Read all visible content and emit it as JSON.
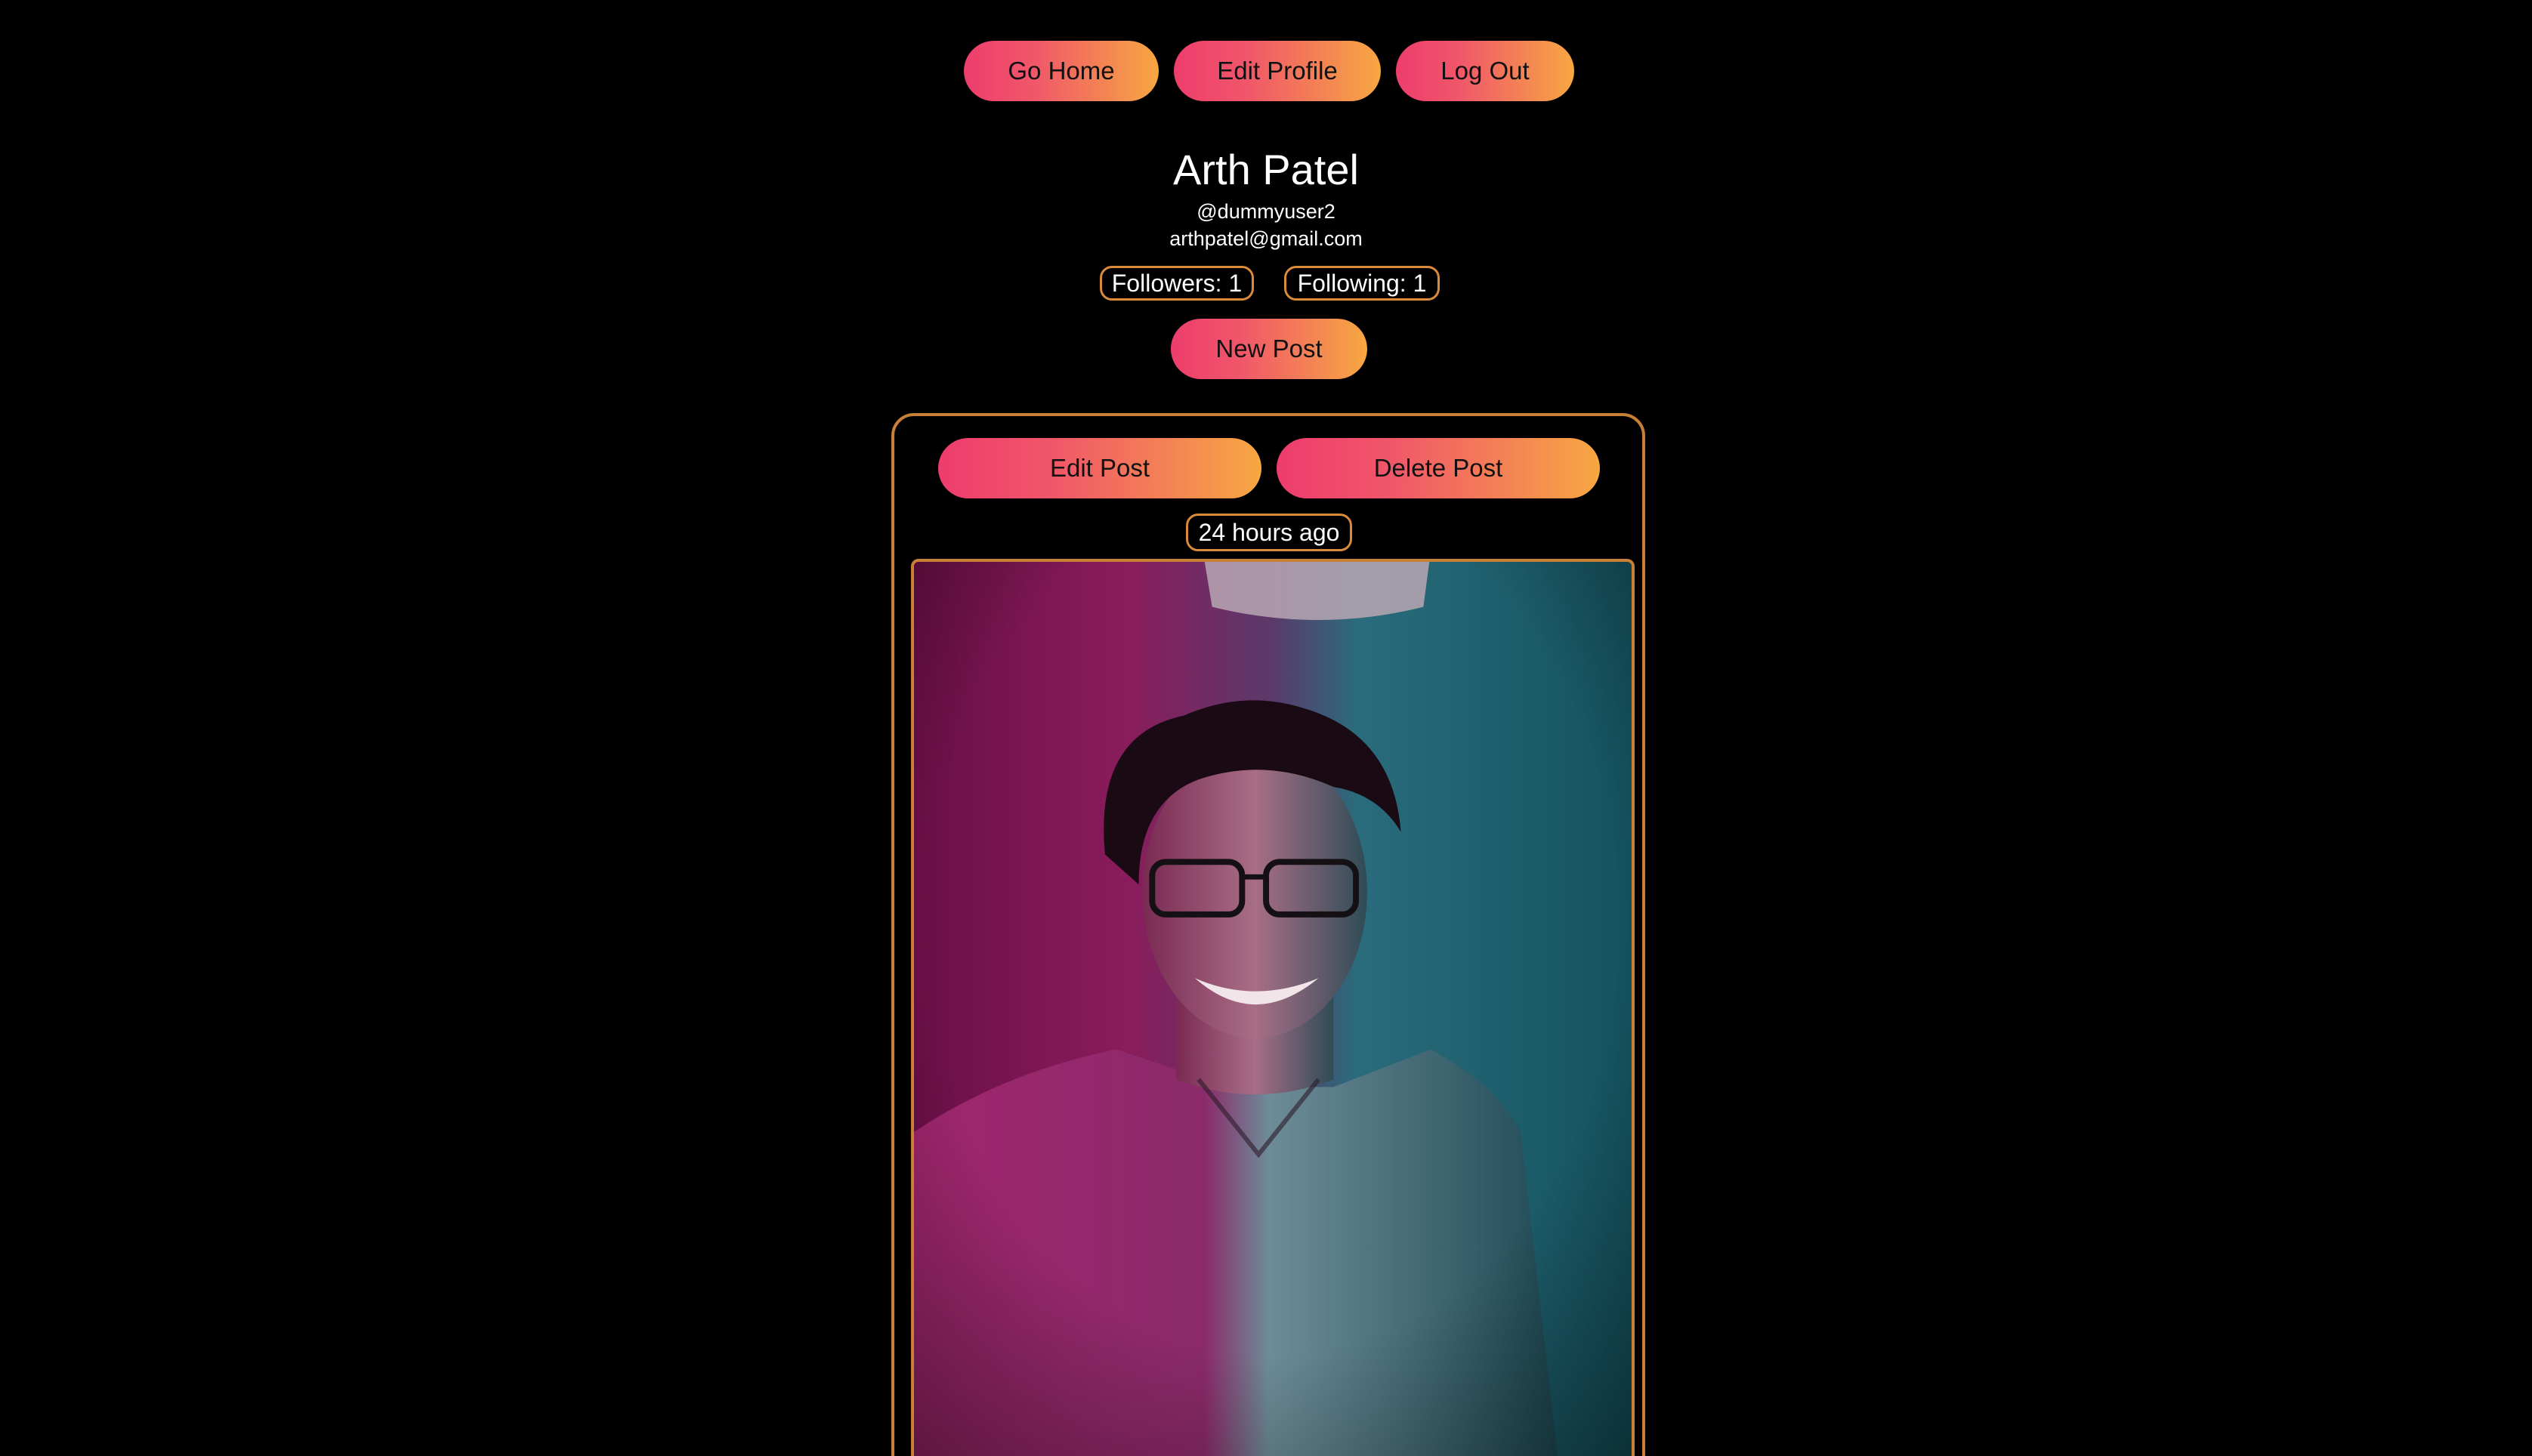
{
  "nav": {
    "home_label": "Go Home",
    "edit_profile_label": "Edit Profile",
    "logout_label": "Log Out"
  },
  "profile": {
    "name": "Arth Patel",
    "handle": "@dummyuser2",
    "email": "arthpatel@gmail.com",
    "followers_text": "Followers: 1",
    "following_text": "Following: 1",
    "new_post_label": "New Post"
  },
  "post": {
    "edit_label": "Edit Post",
    "delete_label": "Delete Post",
    "timestamp": "24 hours ago"
  },
  "colors": {
    "background": "#000000",
    "button_gradient_start": "#ee3d6c",
    "button_gradient_end": "#f7a742",
    "border_accent": "#c97f36"
  }
}
